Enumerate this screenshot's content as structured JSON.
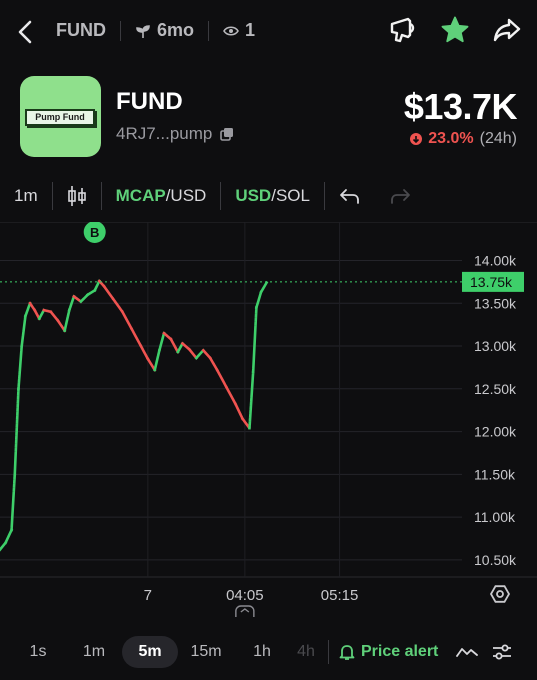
{
  "nav": {
    "token": "FUND",
    "age": "6mo",
    "watchers": "1"
  },
  "token": {
    "logo_text": "Pump Fund",
    "name": "FUND",
    "address": "4RJ7...pump",
    "price": "$13.7K",
    "change_pct": "23.0%",
    "change_period": "(24h)"
  },
  "toolbar": {
    "interval": "1m",
    "mcap": "MCAP",
    "mcap_unit": "/USD",
    "usd": "USD",
    "usd_unit": "/SOL"
  },
  "colors": {
    "accent": "#5fd07a",
    "up": "#3ecf6a",
    "down": "#ef5350",
    "bg": "#0e0e10"
  },
  "chart_data": {
    "type": "line",
    "y_ticks": [
      "14.00k",
      "13.50k",
      "13.00k",
      "12.50k",
      "12.00k",
      "11.50k",
      "11.00k",
      "10.50k"
    ],
    "y_tick_values": [
      14000,
      13500,
      13000,
      12500,
      12000,
      11500,
      11000,
      10500
    ],
    "ylim": [
      10300,
      14450
    ],
    "x_ticks": [
      {
        "label": "7",
        "t": 0.32
      },
      {
        "label": "04:05",
        "t": 0.53
      },
      {
        "label": "05:15",
        "t": 0.735
      }
    ],
    "current_label": "13.75k",
    "current_value": 13750,
    "marker_label": "B",
    "marker_t": 0.205,
    "series": [
      {
        "values": [
          [
            0.0,
            10620
          ],
          [
            0.012,
            10700
          ],
          [
            0.025,
            10850
          ],
          [
            0.032,
            11500
          ],
          [
            0.04,
            12500
          ],
          [
            0.047,
            13000
          ],
          [
            0.055,
            13350
          ],
          [
            0.065,
            13500
          ],
          [
            0.075,
            13420
          ],
          [
            0.085,
            13320
          ],
          [
            0.095,
            13420
          ],
          [
            0.11,
            13400
          ],
          [
            0.125,
            13300
          ],
          [
            0.14,
            13180
          ],
          [
            0.15,
            13420
          ],
          [
            0.16,
            13580
          ],
          [
            0.175,
            13520
          ],
          [
            0.19,
            13600
          ],
          [
            0.205,
            13650
          ],
          [
            0.215,
            13760
          ],
          [
            0.225,
            13700
          ],
          [
            0.245,
            13550
          ],
          [
            0.265,
            13400
          ],
          [
            0.285,
            13200
          ],
          [
            0.305,
            13000
          ],
          [
            0.32,
            12850
          ],
          [
            0.335,
            12720
          ],
          [
            0.345,
            12950
          ],
          [
            0.355,
            13150
          ],
          [
            0.37,
            13080
          ],
          [
            0.385,
            12930
          ],
          [
            0.395,
            13030
          ],
          [
            0.41,
            12960
          ],
          [
            0.425,
            12860
          ],
          [
            0.44,
            12950
          ],
          [
            0.455,
            12860
          ],
          [
            0.47,
            12720
          ],
          [
            0.49,
            12520
          ],
          [
            0.51,
            12320
          ],
          [
            0.525,
            12150
          ],
          [
            0.54,
            12040
          ],
          [
            0.548,
            12700
          ],
          [
            0.555,
            13450
          ],
          [
            0.565,
            13630
          ],
          [
            0.578,
            13750
          ]
        ]
      }
    ]
  },
  "bottom": {
    "timeframes": [
      "1s",
      "1m",
      "5m",
      "15m",
      "1h",
      "4h"
    ],
    "active": "5m",
    "alert": "Price alert"
  }
}
